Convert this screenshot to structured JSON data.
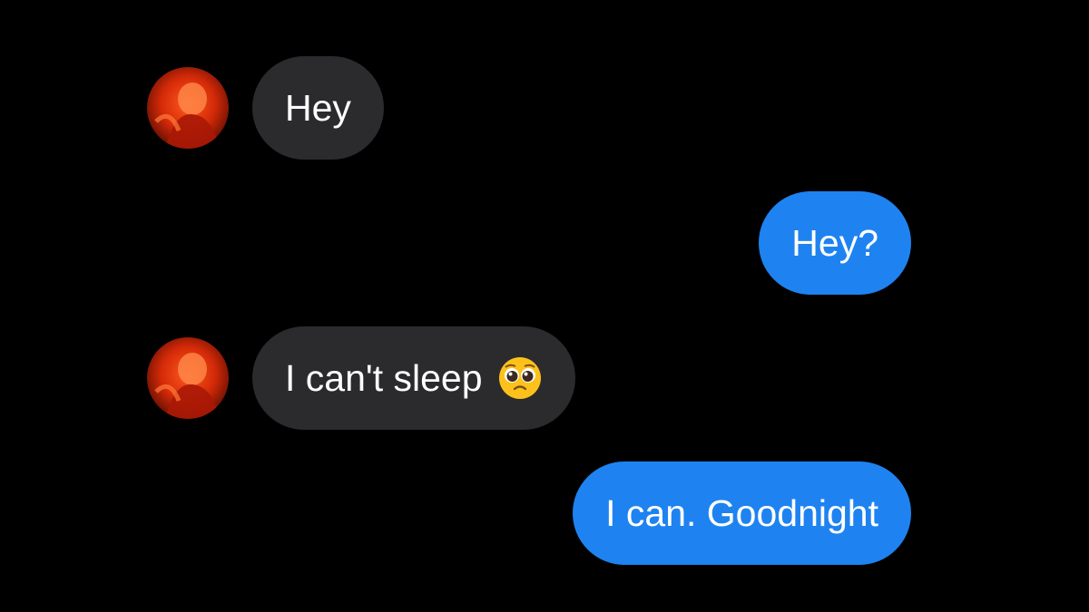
{
  "conversation": {
    "messages": [
      {
        "sender": "contact",
        "text": "Hey",
        "avatar_icon": "contact-avatar"
      },
      {
        "sender": "me",
        "text": "Hey?"
      },
      {
        "sender": "contact",
        "text": "I can't sleep",
        "emoji": "pleading-face-emoji",
        "avatar_icon": "contact-avatar"
      },
      {
        "sender": "me",
        "text": "I can. Goodnight"
      }
    ]
  },
  "colors": {
    "background": "#000000",
    "incoming_bubble": "#2b2b2d",
    "outgoing_bubble": "#1e83f0",
    "text": "#ffffff"
  }
}
